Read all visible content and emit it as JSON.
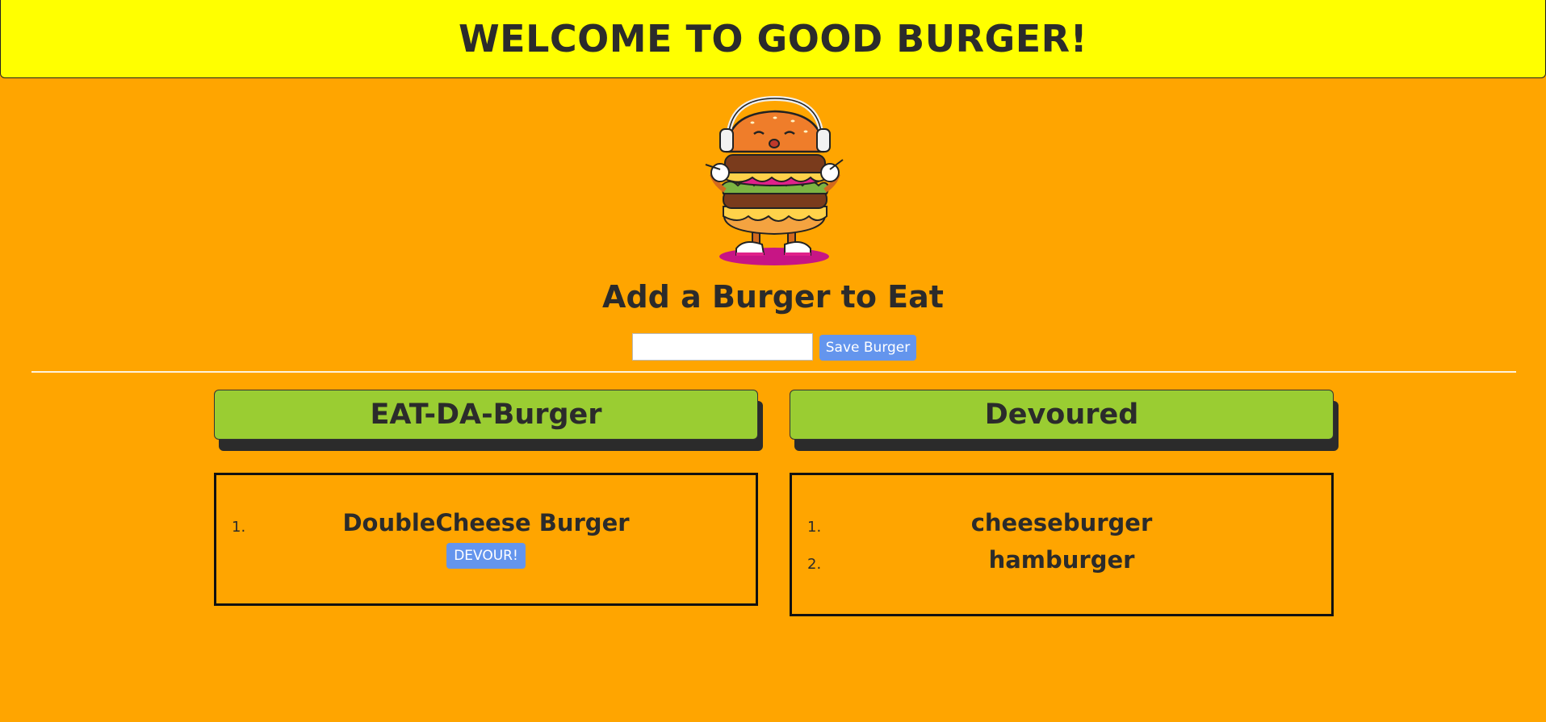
{
  "header": {
    "title": "WELCOME TO GOOD BURGER!"
  },
  "form": {
    "title": "Add a Burger to Eat",
    "input_value": "",
    "save_label": "Save Burger"
  },
  "eat": {
    "title": "EAT-DA-Burger",
    "items": [
      {
        "num": "1.",
        "name": "DoubleCheese Burger",
        "action": "DEVOUR!"
      }
    ]
  },
  "devoured": {
    "title": "Devoured",
    "items": [
      {
        "num": "1.",
        "name": "cheeseburger"
      },
      {
        "num": "2.",
        "name": "hamburger"
      }
    ]
  },
  "colors": {
    "background": "#ffa500",
    "banner": "#ffff00",
    "column_header": "#9acd32",
    "button": "#6495ed"
  },
  "icons": {
    "mascot": "burger-mascot-icon"
  }
}
